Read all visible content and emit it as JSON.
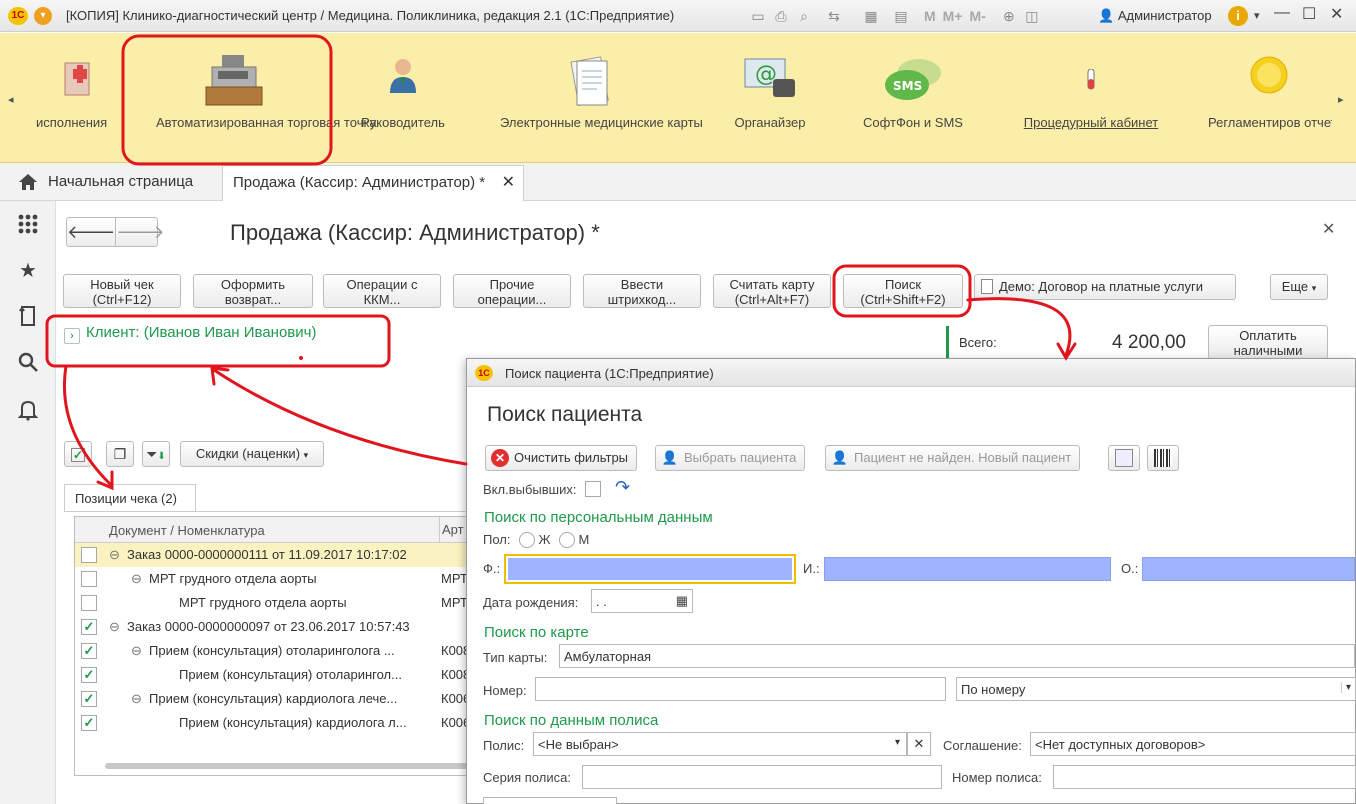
{
  "window": {
    "title": "[КОПИЯ] Клинико-диагностический центр / Медицина. Поликлиника, редакция 2.1  (1С:Предприятие)",
    "user": "Администратор",
    "toolbar_text": [
      "M",
      "M+",
      "M-"
    ]
  },
  "sections": [
    {
      "label": "исполнения",
      "icon": "documents-icon"
    },
    {
      "label": "Автоматизированная торговая точка",
      "icon": "cash-register-icon"
    },
    {
      "label": "Руководитель",
      "icon": "manager-icon"
    },
    {
      "label": "Электронные медицинские карты",
      "icon": "medical-cards-icon"
    },
    {
      "label": "Органайзер",
      "icon": "organizer-icon"
    },
    {
      "label": "СофтФон и SMS",
      "icon": "sms-icon",
      "badge": "SMS"
    },
    {
      "label": "Процедурный кабинет",
      "icon": "test-tube-icon"
    },
    {
      "label": "Регламентированная отчетность",
      "label_visible": "Регламентиров отчетность",
      "icon": "reports-icon"
    }
  ],
  "tabs": {
    "home": "Начальная страница",
    "active": "Продажа (Кассир: Администратор) *"
  },
  "form": {
    "title": "Продажа (Кассир: Администратор) *",
    "buttons": [
      {
        "line1": "Новый чек",
        "line2": "(Ctrl+F12)"
      },
      {
        "line1": "Оформить",
        "line2": "возврат..."
      },
      {
        "line1": "Операции с",
        "line2": "ККМ..."
      },
      {
        "line1": "Прочие",
        "line2": "операции..."
      },
      {
        "line1": "Ввести",
        "line2": "штрихкод..."
      },
      {
        "line1": "Считать карту",
        "line2": "(Ctrl+Alt+F7)"
      },
      {
        "line1": "Поиск",
        "line2": "(Ctrl+Shift+F2)"
      }
    ],
    "contract_button": "Демо: Договор на платные услуги",
    "more_button": "Еще",
    "client": "Клиент: (Иванов Иван Иванович)",
    "total_label": "Всего:",
    "total_value": "4 200,00",
    "pay_cash": {
      "line1": "Оплатить",
      "line2": "наличными"
    },
    "discounts_button": "Скидки (наценки)",
    "positions_tab": "Позиции чека (2)",
    "grid": {
      "columns": [
        "Документ / Номенклатура",
        "Арт"
      ],
      "rows": [
        {
          "checked": false,
          "level": 0,
          "text": "Заказ 0000-0000000111 от 11.09.2017 10:17:02",
          "art": ""
        },
        {
          "checked": false,
          "level": 1,
          "text": "МРТ грудного отдела аорты",
          "art": "МРТ"
        },
        {
          "checked": false,
          "level": 2,
          "text": "МРТ грудного отдела аорты",
          "art": "МРТ"
        },
        {
          "checked": true,
          "level": 0,
          "text": "Заказ 0000-0000000097 от 23.06.2017 10:57:43",
          "art": ""
        },
        {
          "checked": true,
          "level": 1,
          "text": "Прием (консультация) отоларинголога ...",
          "art": "К008"
        },
        {
          "checked": true,
          "level": 2,
          "text": "Прием (консультация) отоларингол...",
          "art": "К008"
        },
        {
          "checked": true,
          "level": 1,
          "text": "Прием (консультация) кардиолога лече...",
          "art": "К006"
        },
        {
          "checked": true,
          "level": 2,
          "text": "Прием (консультация) кардиолога л...",
          "art": "К006"
        }
      ]
    }
  },
  "modal": {
    "window_title": "Поиск пациента  (1С:Предприятие)",
    "heading": "Поиск пациента",
    "clear_filters": "Очистить фильтры",
    "select_patient": "Выбрать пациента",
    "not_found": "Пациент не найден. Новый пациент",
    "incl_retired": "Вкл.выбывших:",
    "group_personal": "Поиск по персональным данным",
    "sex_label": "Пол:",
    "sex_f": "Ж",
    "sex_m": "М",
    "f_label": "Ф.:",
    "i_label": "И.:",
    "o_label": "О.:",
    "birth_label": "Дата рождения:",
    "birth_value": " .  .",
    "group_card": "Поиск по  карте",
    "card_type_label": "Тип карты:",
    "card_type_value": "Амбулаторная",
    "number_label": "Номер:",
    "number_mode": "По номеру",
    "group_policy": "Поиск по данным полиса",
    "policy_label": "Полис:",
    "policy_value": "<Не выбран>",
    "agreement_label": "Соглашение:",
    "agreement_value": "<Нет доступных договоров>",
    "series_label": "Серия полиса:",
    "policy_number_label": "Номер полиса:"
  },
  "colors": {
    "accent_green": "#1d9a4a",
    "sections_bg": "#fbeea9",
    "annotation_red": "#e0161f",
    "field_blue": "#9fb4ff"
  }
}
